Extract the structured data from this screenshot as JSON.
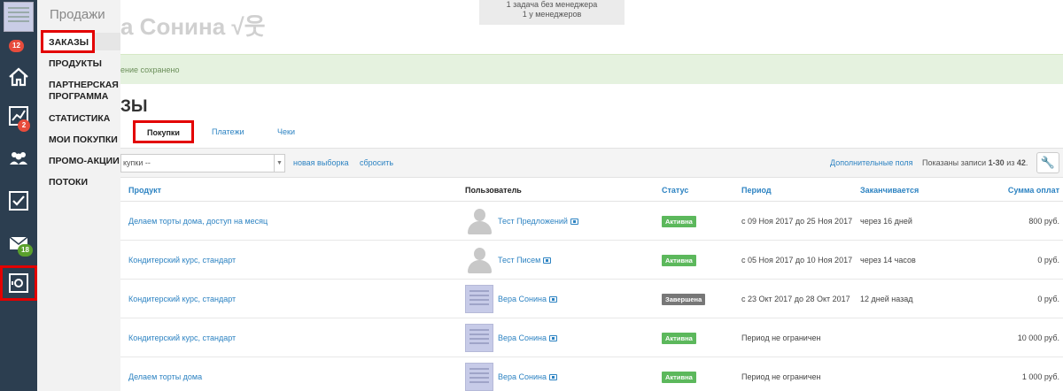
{
  "rail": {
    "badges": {
      "dashboard": "12",
      "analytics": "2",
      "messages": "18"
    },
    "icons": [
      "avatar",
      "home-icon",
      "chart-icon",
      "users-icon",
      "tasks-icon",
      "mail-icon",
      "safe-icon"
    ]
  },
  "submenu": {
    "title": "Продажи",
    "items": [
      {
        "label": "ЗАКАЗЫ"
      },
      {
        "label": "ПРОДУКТЫ"
      },
      {
        "label": "ПАРТНЕРСКАЯ ПРОГРАММА"
      },
      {
        "label": "СТАТИСТИКА"
      },
      {
        "label": "МОИ ПОКУПКИ"
      },
      {
        "label": "ПРОМО-АКЦИИ"
      },
      {
        "label": "ПОТОКИ"
      }
    ]
  },
  "header": {
    "title": "а Сонина √웃",
    "notice_line1": "1 задача без менеджера",
    "notice_line2": "1 у менеджеров"
  },
  "notice": {
    "text": "ение сохранено"
  },
  "section": {
    "title": "ЗЫ"
  },
  "tabs": [
    {
      "label": "Покупки"
    },
    {
      "label": "Платежи"
    },
    {
      "label": "Чеки"
    }
  ],
  "toolbar": {
    "select_value": "купки --",
    "new_selection": "новая выборка",
    "reset": "сбросить",
    "extra_fields": "Дополнительные поля",
    "shown_prefix": "Показаны записи",
    "shown_range": "1-30",
    "shown_of": "из",
    "shown_total": "42"
  },
  "table": {
    "headers": {
      "product": "Продукт",
      "user": "Пользователь",
      "status": "Статус",
      "period": "Период",
      "ends": "Заканчивается",
      "sum": "Сумма оплат"
    },
    "rows": [
      {
        "product": "Делаем торты дома, доступ на месяц",
        "user": "Тест Предложений",
        "status": "Активна",
        "period": "с 09 Ноя 2017 до 25 Ноя 2017",
        "ends": "через 16 дней",
        "sum": "800 руб."
      },
      {
        "product": "Кондитерский курс, стандарт",
        "user": "Тест Писем",
        "status": "Активна",
        "period": "с 05 Ноя 2017 до 10 Ноя 2017",
        "ends": "через 14 часов",
        "sum": "0 руб."
      },
      {
        "product": "Кондитерский курс, стандарт",
        "user": "Вера Сонина",
        "status": "Завершена",
        "period": "с 23 Окт 2017 до 28 Окт 2017",
        "ends": "12 дней назад",
        "sum": "0 руб."
      },
      {
        "product": "Кондитерский курс, стандарт",
        "user": "Вера Сонина",
        "status": "Активна",
        "period": "Период не ограничен",
        "ends": "",
        "sum": "10 000 руб."
      },
      {
        "product": "Делаем торты дома",
        "user": "Вера Сонина",
        "status": "Активна",
        "period": "Период не ограничен",
        "ends": "",
        "sum": "1 000 руб."
      }
    ]
  },
  "colors": {
    "accent": "#2d83c2",
    "highlight": "#e30000",
    "rail": "#2c3e50",
    "status_active": "#5cb85c",
    "status_done": "#777777"
  }
}
